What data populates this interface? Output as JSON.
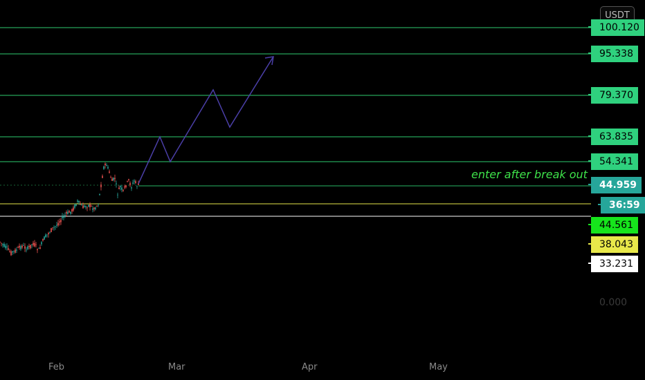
{
  "currency_button": "USDT",
  "annotation": "enter after break out",
  "zero_label": "0.000",
  "x_labels": [
    "Feb",
    "Mar",
    "Apr",
    "May"
  ],
  "colors": {
    "background": "#000000",
    "level_line": "#2ecc71",
    "level_tag": "#2fd17e",
    "current_price_tag": "#26a69a",
    "green_tag": "#16e51c",
    "yellow_line": "#e8e84a",
    "white_line": "#ffffff",
    "projection": "#4b3fa8",
    "bull_candle": "#26a69a",
    "bear_candle": "#ef5350"
  },
  "chart_data": {
    "type": "line",
    "title": "",
    "x_labels": [
      "Feb",
      "Mar",
      "Apr",
      "May"
    ],
    "y_scale": "linear",
    "resistance_levels": [
      100.12,
      95.338,
      79.37,
      63.835,
      54.341
    ],
    "current_price": 44.959,
    "countdown": "36:59",
    "support_levels": [
      {
        "value": 44.561,
        "color": "green"
      },
      {
        "value": 38.043,
        "color": "yellow"
      },
      {
        "value": 33.231,
        "color": "white"
      }
    ],
    "price_path_approx": [
      {
        "date": "late Jan",
        "price": 15
      },
      {
        "date": "early Feb",
        "price": 25
      },
      {
        "date": "mid Feb",
        "price": 38
      },
      {
        "date": "mid Feb",
        "price": 54
      },
      {
        "date": "late Feb",
        "price": 45
      }
    ],
    "projection_path_approx": [
      45,
      63.8,
      54.3,
      79.4,
      70,
      95.3
    ],
    "tags": [
      {
        "label": "100.120",
        "kind": "level"
      },
      {
        "label": "95.338",
        "kind": "level"
      },
      {
        "label": "79.370",
        "kind": "level"
      },
      {
        "label": "63.835",
        "kind": "level"
      },
      {
        "label": "54.341",
        "kind": "level"
      },
      {
        "label": "44.959",
        "kind": "current"
      },
      {
        "label": "36:59",
        "kind": "countdown"
      },
      {
        "label": "44.561",
        "kind": "green"
      },
      {
        "label": "38.043",
        "kind": "yellow"
      },
      {
        "label": "33.231",
        "kind": "white"
      }
    ]
  }
}
